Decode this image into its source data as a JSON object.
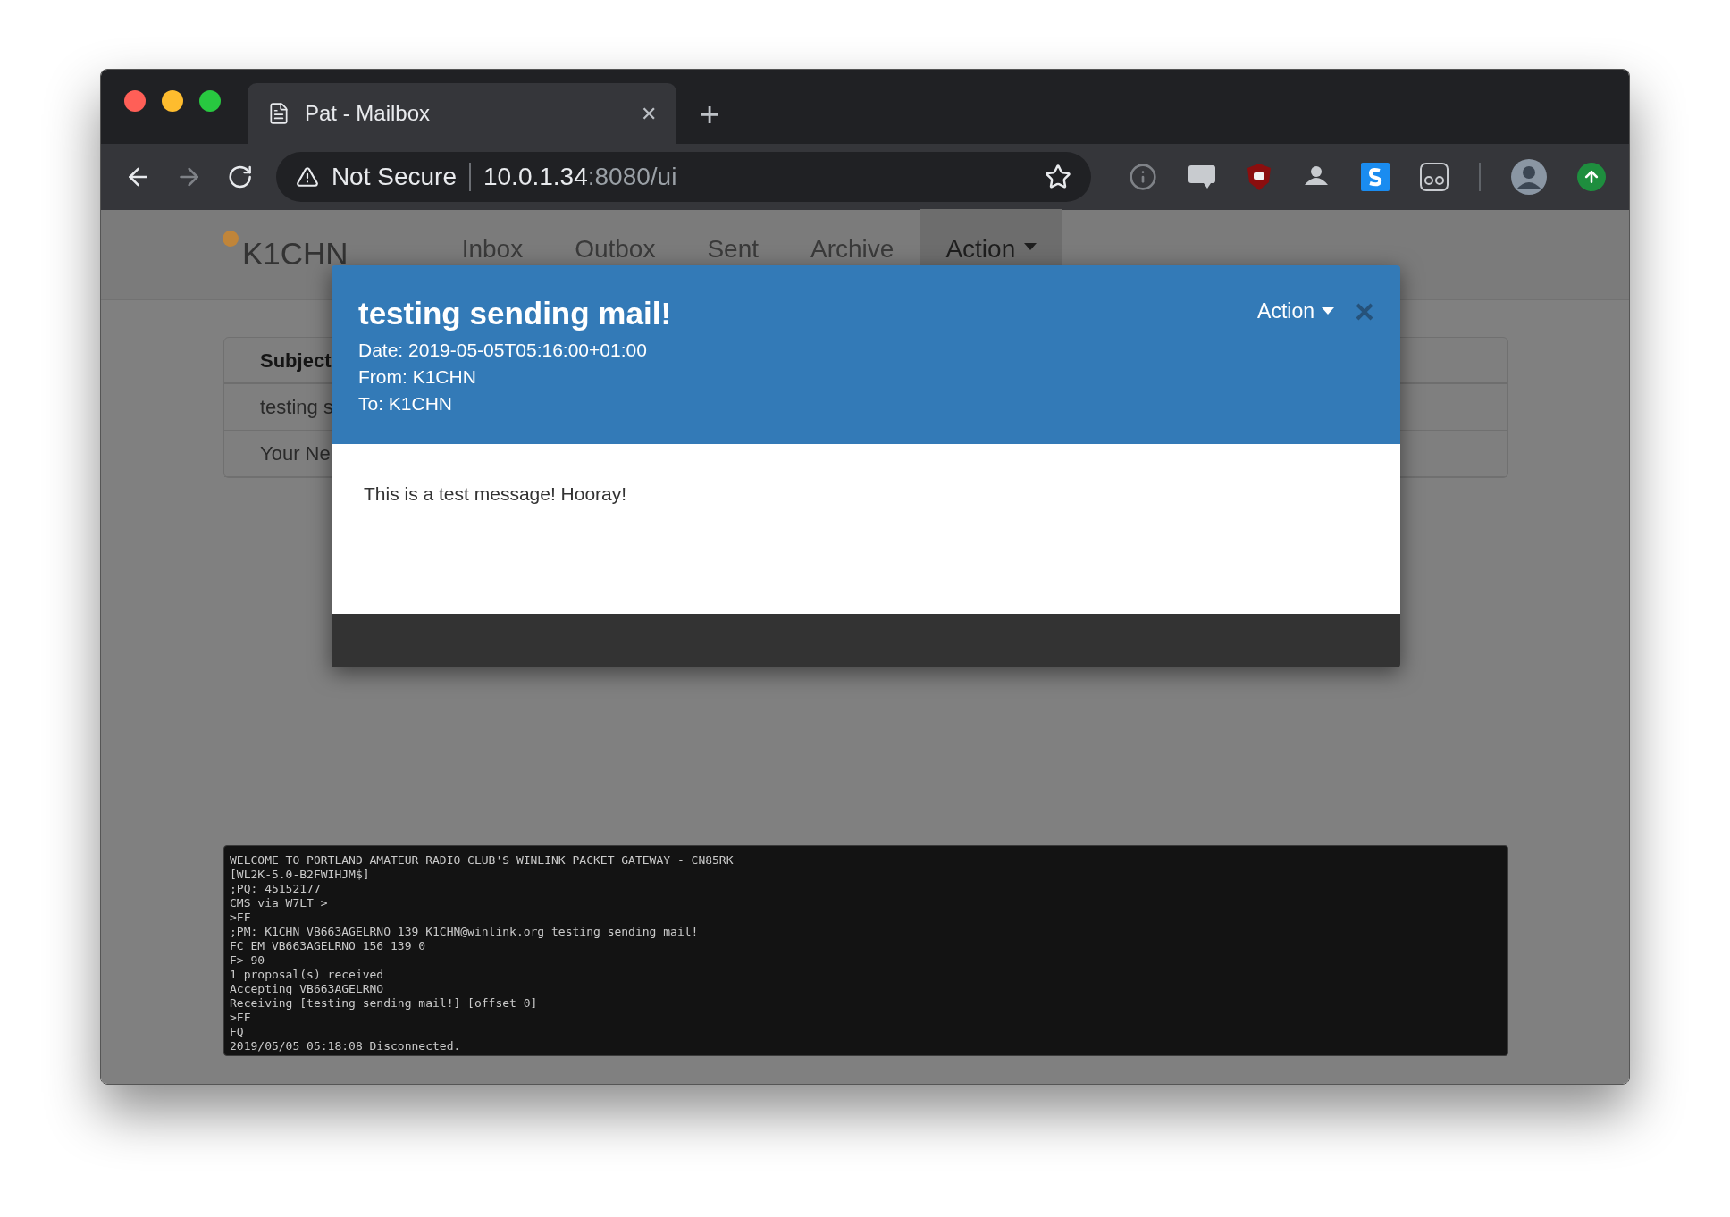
{
  "browser": {
    "tab": {
      "title": "Pat - Mailbox",
      "close": "✕",
      "new_tab": "+"
    },
    "address": {
      "security": "Not Secure",
      "host": "10.0.1.34",
      "path": ":8080/ui"
    }
  },
  "navbar": {
    "brand": "K1CHN",
    "items": [
      {
        "label": "Inbox",
        "selected": false,
        "kind": "link"
      },
      {
        "label": "Outbox",
        "selected": false,
        "kind": "link"
      },
      {
        "label": "Sent",
        "selected": false,
        "kind": "link"
      },
      {
        "label": "Archive",
        "selected": false,
        "kind": "link"
      },
      {
        "label": "Action",
        "selected": true,
        "kind": "dropdown"
      }
    ]
  },
  "table": {
    "columns": [
      "Subject"
    ],
    "rows": [
      [
        "testing s"
      ],
      [
        "Your Ne"
      ]
    ]
  },
  "modal": {
    "title": "testing sending mail!",
    "meta": [
      "Date: 2019-05-05T05:16:00+01:00",
      "From: K1CHN",
      "To: K1CHN"
    ],
    "action": "Action",
    "body": "This is a test message! Hooray!"
  },
  "log": {
    "lines": [
      "WELCOME TO PORTLAND AMATEUR RADIO CLUB'S WINLINK PACKET GATEWAY - CN85RK",
      "[WL2K-5.0-B2FWIHJM$]",
      ";PQ: 45152177",
      "CMS via W7LT >",
      ">FF",
      ";PM: K1CHN VB663AGELRNO 139 K1CHN@winlink.org testing sending mail!",
      "FC EM VB663AGELRNO 156 139 0",
      "F> 90",
      "1 proposal(s) received",
      "Accepting VB663AGELRNO",
      "Receiving [testing sending mail!] [offset 0]",
      ">FF",
      "FQ",
      "2019/05/05 05:18:08 Disconnected."
    ]
  }
}
